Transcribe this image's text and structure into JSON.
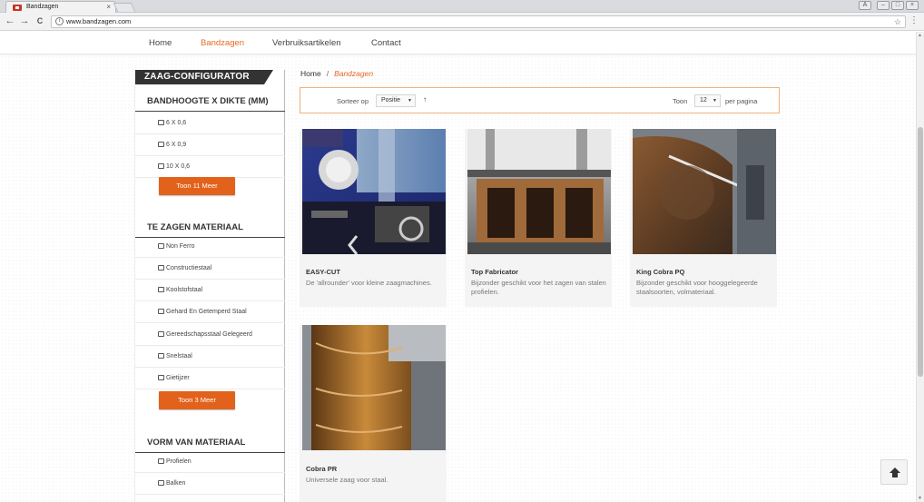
{
  "browser": {
    "tab_title": "Bandzagen",
    "tab_close": "×",
    "url": "www.bandzagen.com",
    "info_glyph": "i",
    "star_glyph": "☆",
    "menu_glyph": "⋮",
    "back_glyph": "←",
    "forward_glyph": "→",
    "reload_glyph": "C",
    "win_user": "A",
    "win_min": "–",
    "win_max": "□",
    "win_close": "×"
  },
  "nav": {
    "items": [
      "Home",
      "Bandzagen",
      "Verbruiksartikelen",
      "Contact"
    ],
    "active_index": 1
  },
  "sidebar": {
    "configurator_title": "ZAAG-CONFIGURATOR",
    "sections": [
      {
        "title": "BANDHOOGTE X DIKTE (MM)",
        "items": [
          "6 X 0,6",
          "6 X 0,9",
          "10 X 0,6"
        ],
        "more_label": "Toon 11 Meer"
      },
      {
        "title": "TE ZAGEN MATERIAAL",
        "items": [
          "Non Ferro",
          "Constructiestaal",
          "Koolstofstaal",
          "Gehard En Getemperd Staal",
          "Gereedschapsstaal Gelegeerd",
          "Snelstaal",
          "Gietijzer"
        ],
        "more_label": "Toon 3 Meer"
      },
      {
        "title": "VORM VAN MATERIAAL",
        "items": [
          "Profielen",
          "Balken"
        ]
      }
    ]
  },
  "breadcrumb": {
    "home": "Home",
    "separator": "/",
    "current": "Bandzagen"
  },
  "sortbar": {
    "sort_label": "Sorteer op",
    "sort_value": "Positie",
    "sort_dir_glyph": "↑",
    "show_label": "Toon",
    "show_value": "12",
    "per_page_label": "per pagina",
    "caret": "▼"
  },
  "products": [
    {
      "title": "EASY-CUT",
      "description": "De 'allrounder' voor kleine zaagmachines."
    },
    {
      "title": "Top Fabricator",
      "description": "Bijzonder geschikt voor het zagen van stalen profielen."
    },
    {
      "title": "King Cobra PQ",
      "description": "Bijzonder geschikt voor hooggelegeerde staalsoorten, volmateriaal."
    },
    {
      "title": "Cobra PR",
      "description": "Universele zaag voor staal."
    }
  ],
  "colors": {
    "accent": "#e36a22",
    "button": "#e2621b",
    "dark": "#333333"
  }
}
